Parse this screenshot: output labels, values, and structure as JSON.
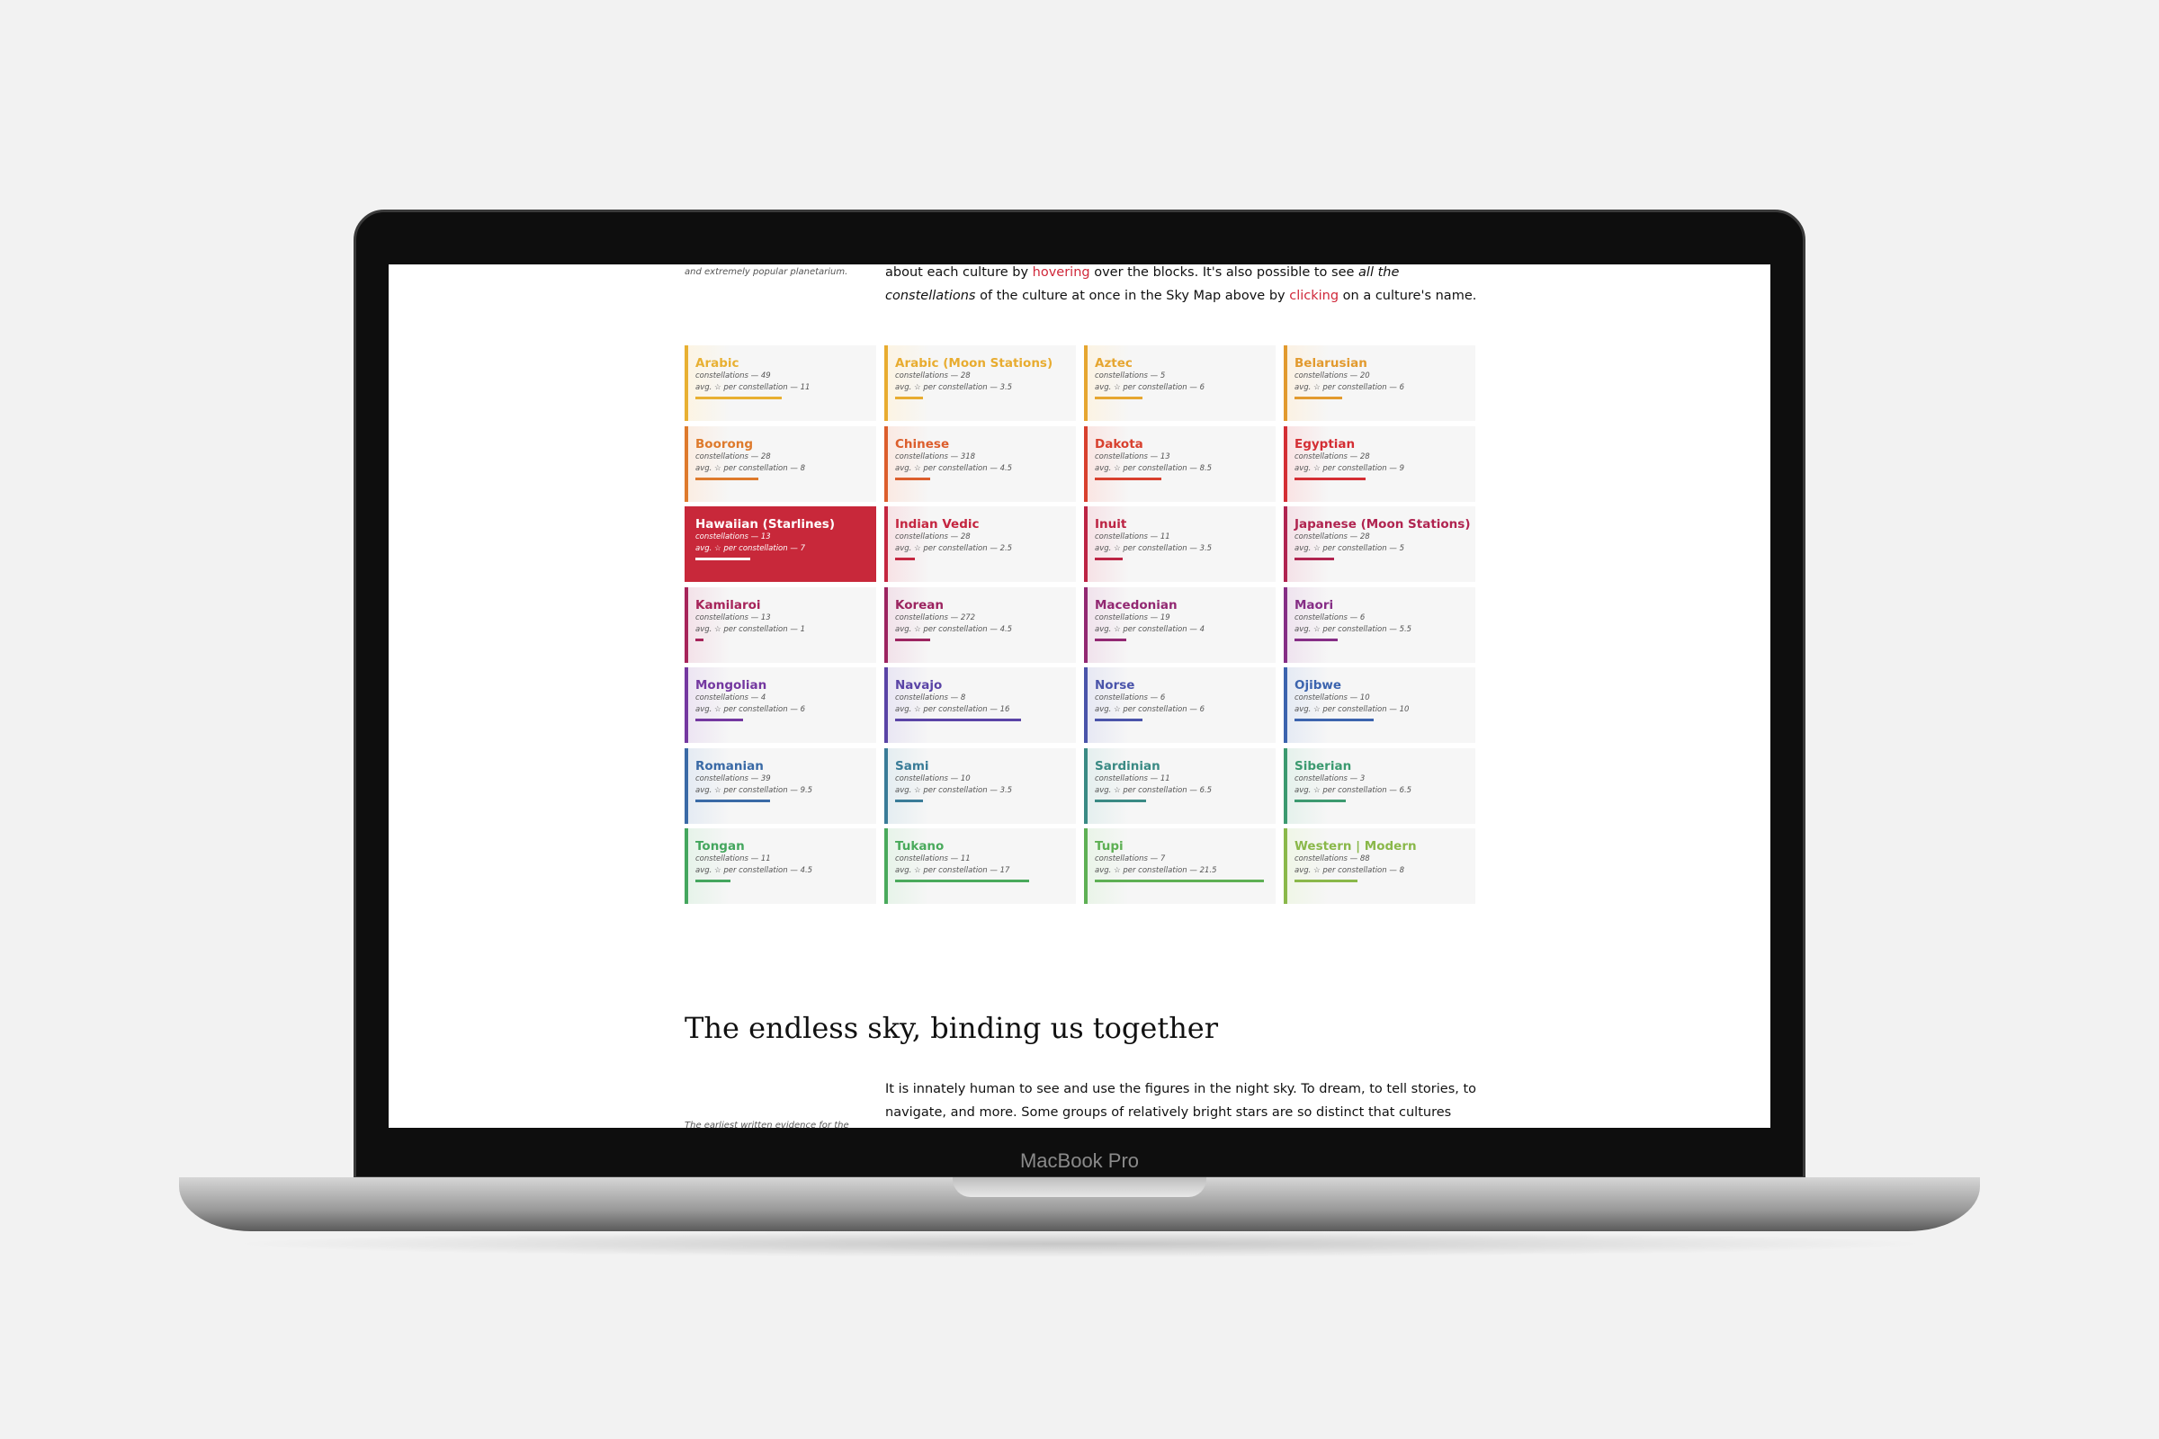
{
  "device_label": "MacBook Pro",
  "intro": {
    "side_note": "and extremely popular planetarium.",
    "line1_a": "about each culture by ",
    "line1_link": "hovering",
    "line1_b": " over the blocks. It's also possible to see ",
    "line1_em": "all the",
    "line2_em": "constellations",
    "line2_a": " of the culture at once in the Sky Map above by ",
    "line2_link": "clicking",
    "line2_b": " on a culture's name."
  },
  "labels": {
    "constellations": "constellations — ",
    "avg": "avg. ☆ per constellation — "
  },
  "active_culture": "Hawaiian (Starlines)",
  "cultures": [
    {
      "name": "Arabic",
      "constellations": "49",
      "avg": "11",
      "color": "#e8b032"
    },
    {
      "name": "Arabic (Moon Stations)",
      "constellations": "28",
      "avg": "3.5",
      "color": "#e8ac30"
    },
    {
      "name": "Aztec",
      "constellations": "5",
      "avg": "6",
      "color": "#e6a630"
    },
    {
      "name": "Belarusian",
      "constellations": "20",
      "avg": "6",
      "color": "#e29a2e"
    },
    {
      "name": "Boorong",
      "constellations": "28",
      "avg": "8",
      "color": "#de7a2c"
    },
    {
      "name": "Chinese",
      "constellations": "318",
      "avg": "4.5",
      "color": "#dc5e2c"
    },
    {
      "name": "Dakota",
      "constellations": "13",
      "avg": "8.5",
      "color": "#d8402e"
    },
    {
      "name": "Egyptian",
      "constellations": "28",
      "avg": "9",
      "color": "#d42e34"
    },
    {
      "name": "Hawaiian (Starlines)",
      "constellations": "13",
      "avg": "7",
      "color": "#c8283a"
    },
    {
      "name": "Indian Vedic",
      "constellations": "28",
      "avg": "2.5",
      "color": "#c42640"
    },
    {
      "name": "Inuit",
      "constellations": "11",
      "avg": "3.5",
      "color": "#bc2444"
    },
    {
      "name": "Japanese (Moon Stations)",
      "constellations": "28",
      "avg": "5",
      "color": "#b02450"
    },
    {
      "name": "Kamilaroi",
      "constellations": "13",
      "avg": "1",
      "color": "#a6245a"
    },
    {
      "name": "Korean",
      "constellations": "272",
      "avg": "4.5",
      "color": "#9c2460"
    },
    {
      "name": "Macedonian",
      "constellations": "19",
      "avg": "4",
      "color": "#922872"
    },
    {
      "name": "Maori",
      "constellations": "6",
      "avg": "5.5",
      "color": "#862e86"
    },
    {
      "name": "Mongolian",
      "constellations": "4",
      "avg": "6",
      "color": "#7438a0"
    },
    {
      "name": "Navajo",
      "constellations": "8",
      "avg": "16",
      "color": "#5a44a6"
    },
    {
      "name": "Norse",
      "constellations": "6",
      "avg": "6",
      "color": "#4a54aa"
    },
    {
      "name": "Ojibwe",
      "constellations": "10",
      "avg": "10",
      "color": "#3c64ae"
    },
    {
      "name": "Romanian",
      "constellations": "39",
      "avg": "9.5",
      "color": "#3a6aa6"
    },
    {
      "name": "Sami",
      "constellations": "10",
      "avg": "3.5",
      "color": "#3a7c98"
    },
    {
      "name": "Sardinian",
      "constellations": "11",
      "avg": "6.5",
      "color": "#3a8a84"
    },
    {
      "name": "Siberian",
      "constellations": "3",
      "avg": "6.5",
      "color": "#3c9a70"
    },
    {
      "name": "Tongan",
      "constellations": "11",
      "avg": "4.5",
      "color": "#44a65e"
    },
    {
      "name": "Tukano",
      "constellations": "11",
      "avg": "17",
      "color": "#4aaa5c"
    },
    {
      "name": "Tupi",
      "constellations": "7",
      "avg": "21.5",
      "color": "#5eb054"
    },
    {
      "name": "Western | Modern",
      "constellations": "88",
      "avg": "8",
      "color": "#8ab84a"
    }
  ],
  "section": {
    "heading": "The endless sky, binding us together",
    "body_line1": "It is innately human to see and use the figures in the night sky. To dream, to tell stories, to",
    "body_line2": "navigate, and more. Some groups of relatively bright stars are so distinct that cultures",
    "side_note": "The earliest written evidence for the"
  }
}
